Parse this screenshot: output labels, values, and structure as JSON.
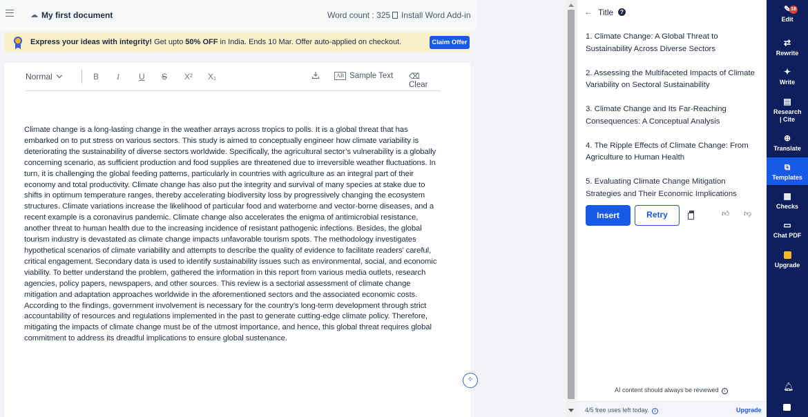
{
  "topbar": {
    "doc_title": "My first document",
    "word_count": "Word count : 325",
    "install_addin": "Install Word Add-in"
  },
  "promo": {
    "bold_lead": "Express your ideas with integrity!",
    "text_a": " Get upto ",
    "bold_offer": "50% OFF",
    "text_b": " in India. Ends 10 Mar. Offer auto-applied on checkout.",
    "claim_label": "Claim Offer"
  },
  "toolbar": {
    "style_select": "Normal",
    "bold": "B",
    "italic": "I",
    "underline": "U",
    "strike": "S",
    "superscript": "X²",
    "subscript": "X₁",
    "sample_text_badge": "AB",
    "sample_text": "Sample Text",
    "clear": "Clear"
  },
  "document": {
    "body": "Climate change is a long-lasting change in the weather arrays across tropics to polls. It is a global threat that has embarked on to put stress on various sectors. This study is aimed to conceptually engineer how climate variability is deteriorating the sustainability of diverse sectors worldwide. Specifically, the agricultural sector’s vulnerability is a globally concerning scenario, as sufficient production and food supplies are threatened due to irreversible weather fluctuations. In turn, it is challenging the global feeding patterns, particularly in countries with agriculture as an integral part of their economy and total productivity. Climate change has also put the integrity and survival of many species at stake due to shifts in optimum temperature ranges, thereby accelerating biodiversity loss by progressively changing the ecosystem structures. Climate variations increase the likelihood of particular food and waterborne and vector-borne diseases, and a recent example is a coronavirus pandemic. Climate change also accelerates the enigma of antimicrobial resistance, another threat to human health due to the increasing incidence of resistant pathogenic infections. Besides, the global tourism industry is devastated as climate change impacts unfavorable tourism spots. The methodology investigates hypothetical scenarios of climate variability and attempts to describe the quality of evidence to facilitate readers’ careful, critical engagement. Secondary data is used to identify sustainability issues such as environmental, social, and economic viability. To better understand the problem, gathered the information in this report from various media outlets, research agencies, policy papers, newspapers, and other sources. This review is a sectorial assessment of climate change mitigation and adaptation approaches worldwide in the aforementioned sectors and the associated economic costs. According to the findings, government involvement is necessary for the country’s long-term development through strict accountability of resources and regulations implemented in the past to generate cutting-edge climate policy. Therefore, mitigating the impacts of climate change must be of the utmost importance, and hence, this global threat requires global commitment to address its dreadful implications to ensure global sustenance."
  },
  "panel": {
    "title": "Title",
    "results": [
      "1. Climate Change: A Global Threat to Sustainability Across Diverse Sectors",
      "2. Assessing the Multifaceted Impacts of Climate Variability on Sectoral Sustainability",
      "3. Climate Change and Its Far-Reaching Consequences: A Conceptual Analysis",
      "4. The Ripple Effects of Climate Change: From Agriculture to Human Health",
      "5. Evaluating Climate Change Mitigation Strategies and Their Economic Implications"
    ],
    "insert_label": "Insert",
    "retry_label": "Retry",
    "ai_note": "AI content should always be reviewed",
    "uses_left": "4/5 free uses left today.",
    "upgrade_link": "Upgrade"
  },
  "sidebar": {
    "badge_count": "18",
    "items": [
      {
        "label": "Edit",
        "icon": "pen-icon"
      },
      {
        "label": "Rewrite",
        "icon": "refresh-icon"
      },
      {
        "label": "Write",
        "icon": "sparkle-icon"
      },
      {
        "label": "Research | Cite",
        "icon": "book-icon"
      },
      {
        "label": "Translate",
        "icon": "globe-icon"
      },
      {
        "label": "Templates",
        "icon": "templates-icon"
      },
      {
        "label": "Checks",
        "icon": "checks-icon"
      },
      {
        "label": "Chat PDF",
        "icon": "chat-icon"
      },
      {
        "label": "Upgrade",
        "icon": "upgrade-icon"
      }
    ]
  },
  "colors": {
    "accent": "#1859e8",
    "sidebar_bg": "#0c1f5c",
    "promo_bg": "#fbf0c7"
  }
}
